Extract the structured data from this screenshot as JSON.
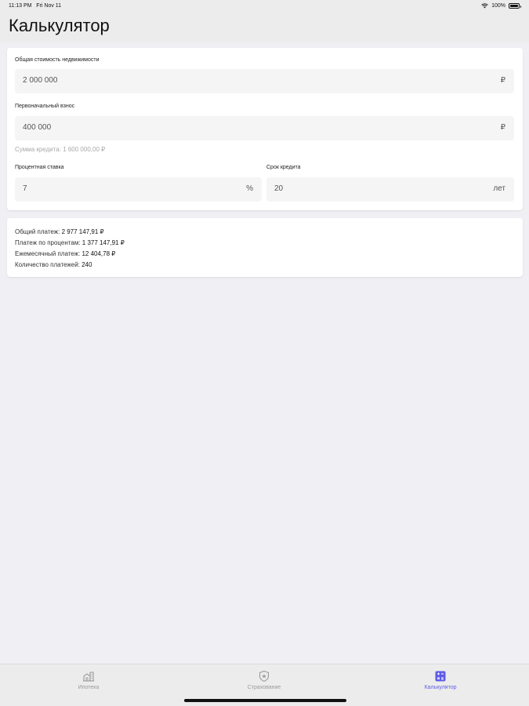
{
  "status_bar": {
    "time": "11:13 PM",
    "date": "Fri Nov 11",
    "battery": "100%"
  },
  "header": {
    "title": "Калькулятор"
  },
  "form": {
    "property_cost": {
      "label": "Общая стоимость недвижимости",
      "value": "2 000 000",
      "unit": "₽"
    },
    "down_payment": {
      "label": "Первоначальный взнос",
      "value": "400 000",
      "unit": "₽"
    },
    "loan_amount_text": "Сумма кредита: 1 600 000,00 ₽",
    "interest_rate": {
      "label": "Процентная ставка",
      "value": "7",
      "unit": "%"
    },
    "loan_term": {
      "label": "Срок кредита",
      "value": "20",
      "unit": "лет"
    }
  },
  "results": {
    "total_payment": {
      "label": "Общий платеж: ",
      "value": "2 977 147,91 ₽"
    },
    "interest_payment": {
      "label": "Платеж по процентам: ",
      "value": "1 377 147,91 ₽"
    },
    "monthly_payment": {
      "label": "Ежемесячный платеж: ",
      "value": "12 404,78 ₽"
    },
    "payments_count": {
      "label": "Количество платежей: ",
      "value": "240"
    }
  },
  "tabs": [
    {
      "label": "Ипотека",
      "icon": "home-building-icon",
      "active": false
    },
    {
      "label": "Страхование",
      "icon": "shield-icon",
      "active": false
    },
    {
      "label": "Калькулятор",
      "icon": "calculator-icon",
      "active": true
    }
  ],
  "colors": {
    "accent": "#5e5ce6",
    "inactive_tab": "#9a9a9a",
    "background": "#efeff4",
    "field_background": "#f5f5f5"
  }
}
